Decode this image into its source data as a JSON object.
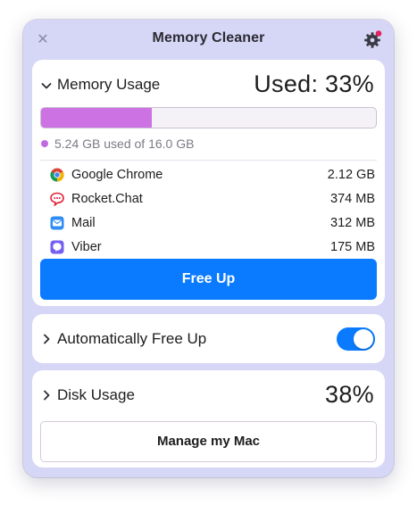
{
  "window": {
    "title": "Memory Cleaner",
    "close_icon": "close-icon",
    "settings_icon": "gear-icon"
  },
  "memory": {
    "section_title": "Memory Usage",
    "used_label": "Used: 33%",
    "used_fraction": 0.33,
    "used_text": "5.24 GB used of 16.0 GB",
    "bar_color": "#cd72e3",
    "apps": [
      {
        "name": "Google Chrome",
        "size": "2.12 GB",
        "icon": "chrome-icon"
      },
      {
        "name": "Rocket.Chat",
        "size": "374 MB",
        "icon": "rocket-chat-icon"
      },
      {
        "name": "Mail",
        "size": "312 MB",
        "icon": "mail-icon"
      },
      {
        "name": "Viber",
        "size": "175 MB",
        "icon": "viber-icon"
      }
    ],
    "free_up_label": "Free Up"
  },
  "auto": {
    "label": "Automatically Free Up",
    "enabled": true
  },
  "disk": {
    "section_title": "Disk Usage",
    "value": "38%",
    "manage_label": "Manage my Mac"
  },
  "colors": {
    "accent": "#0a7bff",
    "window_bg": "#d6d6f7",
    "notification_dot": "#e0245e"
  }
}
